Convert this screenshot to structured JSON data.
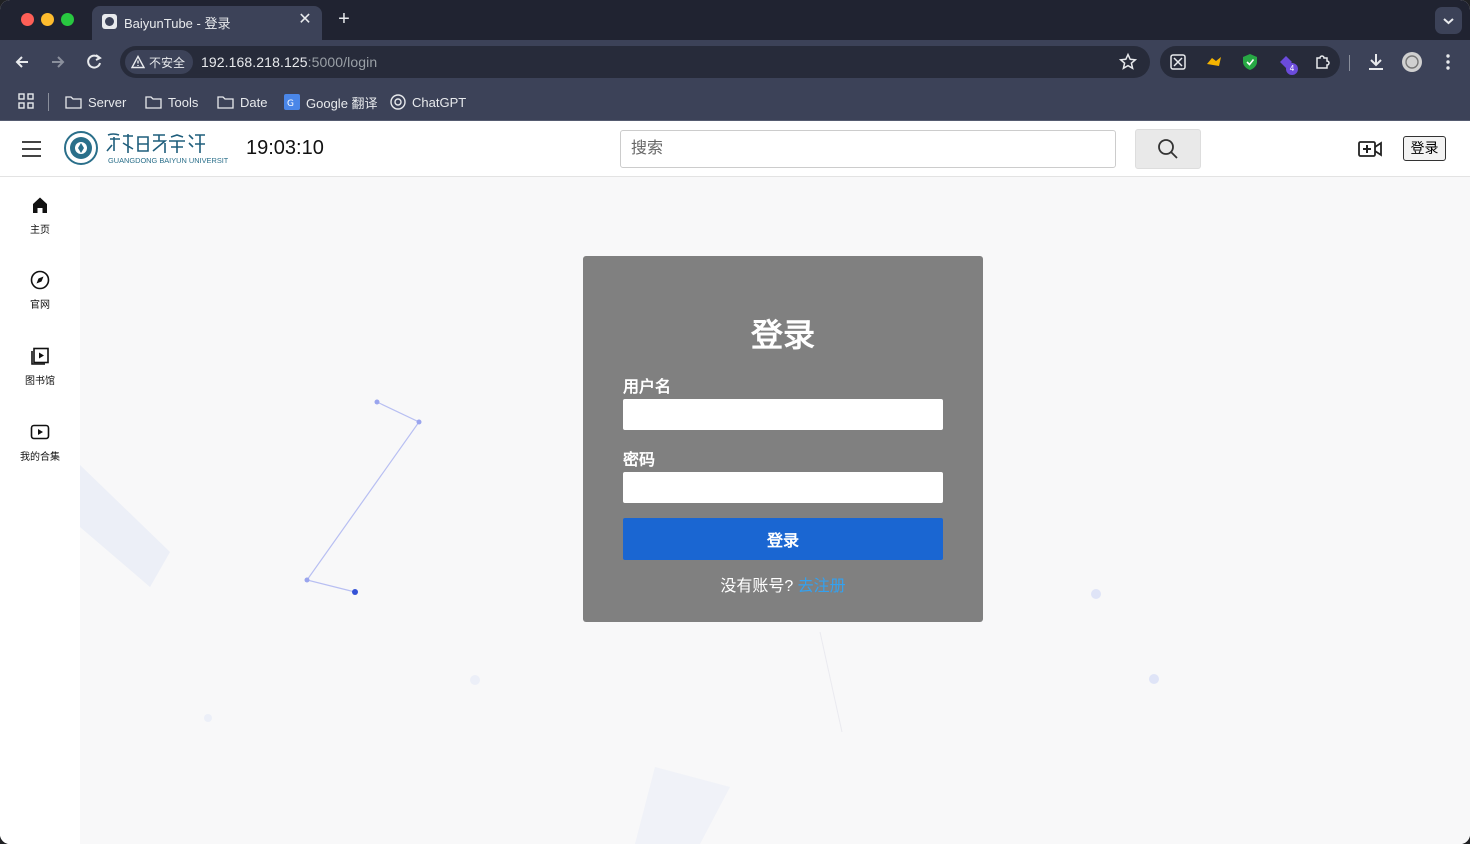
{
  "browser": {
    "tab_title": "BaiyunTube - 登录",
    "security_label": "不安全",
    "url_host": "192.168.218.125",
    "url_path": ":5000/login",
    "extension_badge": "4",
    "bookmarks": [
      "Server",
      "Tools",
      "Date",
      "Google 翻译",
      "ChatGPT"
    ]
  },
  "header": {
    "clock": "19:03:10",
    "search_placeholder": "搜索",
    "login_label": "登录"
  },
  "sidebar": {
    "items": [
      {
        "label": "主页",
        "icon": "home-icon"
      },
      {
        "label": "官网",
        "icon": "compass-icon"
      },
      {
        "label": "图书馆",
        "icon": "library-icon"
      },
      {
        "label": "我的合集",
        "icon": "play-icon"
      }
    ]
  },
  "login_form": {
    "title": "登录",
    "username_label": "用户名",
    "username_value": "",
    "password_label": "密码",
    "password_value": "",
    "submit_label": "登录",
    "no_account_text": "没有账号?",
    "register_link": "去注册"
  },
  "colors": {
    "card_bg": "#808080",
    "submit_bg": "#1a66d2",
    "link": "#33a1f0",
    "main_bg": "#f8f8f9"
  }
}
